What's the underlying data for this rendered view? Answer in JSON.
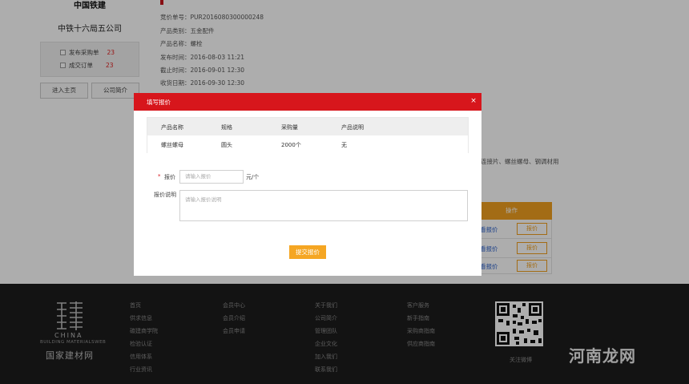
{
  "sidebar": {
    "logo_text": "中国铁建",
    "company_name": "中铁十六局五公司",
    "stats": [
      {
        "label": "发布采购单",
        "count": "23"
      },
      {
        "label": "成交订单",
        "count": "23"
      }
    ],
    "enter_home": "进入主页",
    "company_intro": "公司简介"
  },
  "detail": {
    "inquiry_no": "竞价单号：PUR2016080300000248",
    "category": "产品类别：五金配件",
    "product_name": "产品名称：螺栓",
    "publish_time": "发布时间：2016-08-03 11:21",
    "deadline": "截止时间：2016-09-01 12:30",
    "receive_date": "收货日期：2016-09-30 12:30",
    "desc_fragment": "连接片、螺丝螺母、钢调材用"
  },
  "ops": {
    "header": "操作",
    "rows": [
      {
        "link": "看报价",
        "button": "报价"
      },
      {
        "link": "看报价",
        "button": "报价"
      },
      {
        "link": "看报价",
        "button": "报价"
      }
    ]
  },
  "modal": {
    "title": "填写报价",
    "close": "×",
    "table": {
      "headers": [
        "产品名称",
        "规格",
        "采购量",
        "产品说明"
      ],
      "row": [
        "螺丝螺母",
        "圆头",
        "2000个",
        "无"
      ]
    },
    "required_mark": "*",
    "price_label": "报价",
    "price_placeholder": "请输入报价",
    "price_unit": "元/个",
    "desc_label": "报价说明",
    "desc_placeholder": "请输入报价说明",
    "submit": "提交报价"
  },
  "footer": {
    "logo_en": "CHINA",
    "logo_en2": "BUILDING MATERIALSWEB",
    "logo_cn": "国家建材网",
    "columns": [
      [
        "首页",
        "供求信息",
        "碳建商学院",
        "检验认证",
        "信用体系",
        "行业资讯"
      ],
      [
        "会员中心",
        "会员介绍",
        "会员申请"
      ],
      [
        "关于我们",
        "公司简介",
        "管理团队",
        "企业文化",
        "加入我们",
        "联系我们"
      ],
      [
        "客户服务",
        "新手指南",
        "采购商指南",
        "供应商指南"
      ]
    ],
    "qr_caption": "关注微博"
  },
  "watermark": "河南龙网"
}
